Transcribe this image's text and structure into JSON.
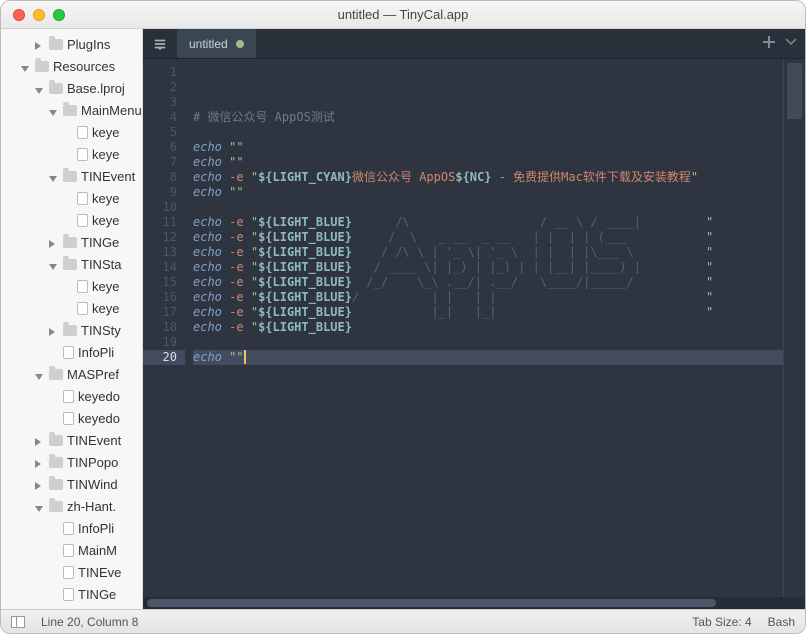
{
  "window": {
    "title": "untitled — TinyCal.app"
  },
  "sidebar": {
    "items": [
      {
        "indent": 2,
        "expand": "right",
        "kind": "folder",
        "label": "PlugIns"
      },
      {
        "indent": 1,
        "expand": "down",
        "kind": "folder",
        "label": "Resources"
      },
      {
        "indent": 2,
        "expand": "down",
        "kind": "folder",
        "label": "Base.lproj"
      },
      {
        "indent": 3,
        "expand": "down",
        "kind": "folder",
        "label": "MainMenu"
      },
      {
        "indent": 4,
        "expand": "",
        "kind": "file",
        "label": "keye"
      },
      {
        "indent": 4,
        "expand": "",
        "kind": "file",
        "label": "keye"
      },
      {
        "indent": 3,
        "expand": "down",
        "kind": "folder",
        "label": "TINEvent"
      },
      {
        "indent": 4,
        "expand": "",
        "kind": "file",
        "label": "keye"
      },
      {
        "indent": 4,
        "expand": "",
        "kind": "file",
        "label": "keye"
      },
      {
        "indent": 3,
        "expand": "right",
        "kind": "folder",
        "label": "TINGe"
      },
      {
        "indent": 3,
        "expand": "down",
        "kind": "folder",
        "label": "TINSta"
      },
      {
        "indent": 4,
        "expand": "",
        "kind": "file",
        "label": "keye"
      },
      {
        "indent": 4,
        "expand": "",
        "kind": "file",
        "label": "keye"
      },
      {
        "indent": 3,
        "expand": "right",
        "kind": "folder",
        "label": "TINSty"
      },
      {
        "indent": 3,
        "expand": "",
        "kind": "file",
        "label": "InfoPli"
      },
      {
        "indent": 2,
        "expand": "down",
        "kind": "folder",
        "label": "MASPref"
      },
      {
        "indent": 3,
        "expand": "",
        "kind": "file",
        "label": "keyedo"
      },
      {
        "indent": 3,
        "expand": "",
        "kind": "file",
        "label": "keyedo"
      },
      {
        "indent": 2,
        "expand": "right",
        "kind": "folder",
        "label": "TINEvent"
      },
      {
        "indent": 2,
        "expand": "right",
        "kind": "folder",
        "label": "TINPopo"
      },
      {
        "indent": 2,
        "expand": "right",
        "kind": "folder",
        "label": "TINWind"
      },
      {
        "indent": 2,
        "expand": "down",
        "kind": "folder",
        "label": "zh-Hant."
      },
      {
        "indent": 3,
        "expand": "",
        "kind": "file",
        "label": "InfoPli"
      },
      {
        "indent": 3,
        "expand": "",
        "kind": "file",
        "label": "MainM"
      },
      {
        "indent": 3,
        "expand": "",
        "kind": "file",
        "label": "TINEve"
      },
      {
        "indent": 3,
        "expand": "",
        "kind": "file",
        "label": "TINGe"
      }
    ]
  },
  "tabs": [
    {
      "label": "untitled",
      "active": true,
      "dirty": true
    }
  ],
  "code": {
    "total_lines": 20,
    "current_line": 20,
    "lines": [
      {
        "n": 1,
        "html": ""
      },
      {
        "n": 2,
        "html": ""
      },
      {
        "n": 3,
        "html": ""
      },
      {
        "n": 4,
        "html": "<span class='cmt'># 微信公众号 AppOS测试</span>"
      },
      {
        "n": 5,
        "html": ""
      },
      {
        "n": 6,
        "html": "<span class='kw'>echo</span> <span class='str'>\"\"</span>"
      },
      {
        "n": 7,
        "html": "<span class='kw'>echo</span> <span class='str'>\"\"</span>"
      },
      {
        "n": 8,
        "html": "<span class='kw'>echo</span> <span class='flg'>-e</span> <span class='str'>\"</span><span class='var'>${LIGHT_CYAN}</span><span class='cn'>微信公众号 AppOS</span><span class='var'>${NC}</span> <span class='op'>-</span> <span class='cn'>免费提供Mac软件下载及安装教程</span><span class='str'>\"</span>"
      },
      {
        "n": 9,
        "html": "<span class='kw'>echo</span> <span class='str'>\"\"</span>"
      },
      {
        "n": 10,
        "html": ""
      },
      {
        "n": 11,
        "html": "<span class='kw'>echo</span> <span class='flg'>-e</span> <span class='str'>\"</span><span class='var'>${LIGHT_BLUE}</span><span class='ascii'>      /\\                  / __ \\ / ____|</span>         <span class='str'>\"</span>"
      },
      {
        "n": 12,
        "html": "<span class='kw'>echo</span> <span class='flg'>-e</span> <span class='str'>\"</span><span class='var'>${LIGHT_BLUE}</span><span class='ascii'>     /  \\   _ __  _ __   | |  | | (___  </span>         <span class='str'>\"</span>"
      },
      {
        "n": 13,
        "html": "<span class='kw'>echo</span> <span class='flg'>-e</span> <span class='str'>\"</span><span class='var'>${LIGHT_BLUE}</span><span class='ascii'>    / /\\ \\ | '_ \\| '_ \\  | |  | |\\___ \\ </span>         <span class='str'>\"</span>"
      },
      {
        "n": 14,
        "html": "<span class='kw'>echo</span> <span class='flg'>-e</span> <span class='str'>\"</span><span class='var'>${LIGHT_BLUE}</span><span class='ascii'>   / ____ \\| |_) | |_) | | |__| |____) |</span>         <span class='str'>\"</span>"
      },
      {
        "n": 15,
        "html": "<span class='kw'>echo</span> <span class='flg'>-e</span> <span class='str'>\"</span><span class='var'>${LIGHT_BLUE}</span><span class='ascii'>  /_/    \\_\\ .__/| .__/   \\____/|_____/ </span>         <span class='str'>\"</span>"
      },
      {
        "n": 16,
        "html": "<span class='kw'>echo</span> <span class='flg'>-e</span> <span class='str'>\"</span><span class='var'>${LIGHT_BLUE}</span><span class='ascii'>/          | |   | |                    </span>         <span class='str'>\"</span>"
      },
      {
        "n": 17,
        "html": "<span class='kw'>echo</span> <span class='flg'>-e</span> <span class='str'>\"</span><span class='var'>${LIGHT_BLUE}</span><span class='ascii'>           |_|   |_|                    </span>         <span class='str'>\"</span>"
      },
      {
        "n": 18,
        "html": "<span class='kw'>echo</span> <span class='flg'>-e</span> <span class='str'>\"</span><span class='var'>${LIGHT_BLUE}</span>"
      },
      {
        "n": 19,
        "html": ""
      },
      {
        "n": 20,
        "html": "<span class='kw'>echo</span> <span class='str'>\"\"</span><span class='cursor'></span>"
      }
    ]
  },
  "statusbar": {
    "position": "Line 20, Column 8",
    "tabsize": "Tab Size: 4",
    "syntax": "Bash"
  }
}
